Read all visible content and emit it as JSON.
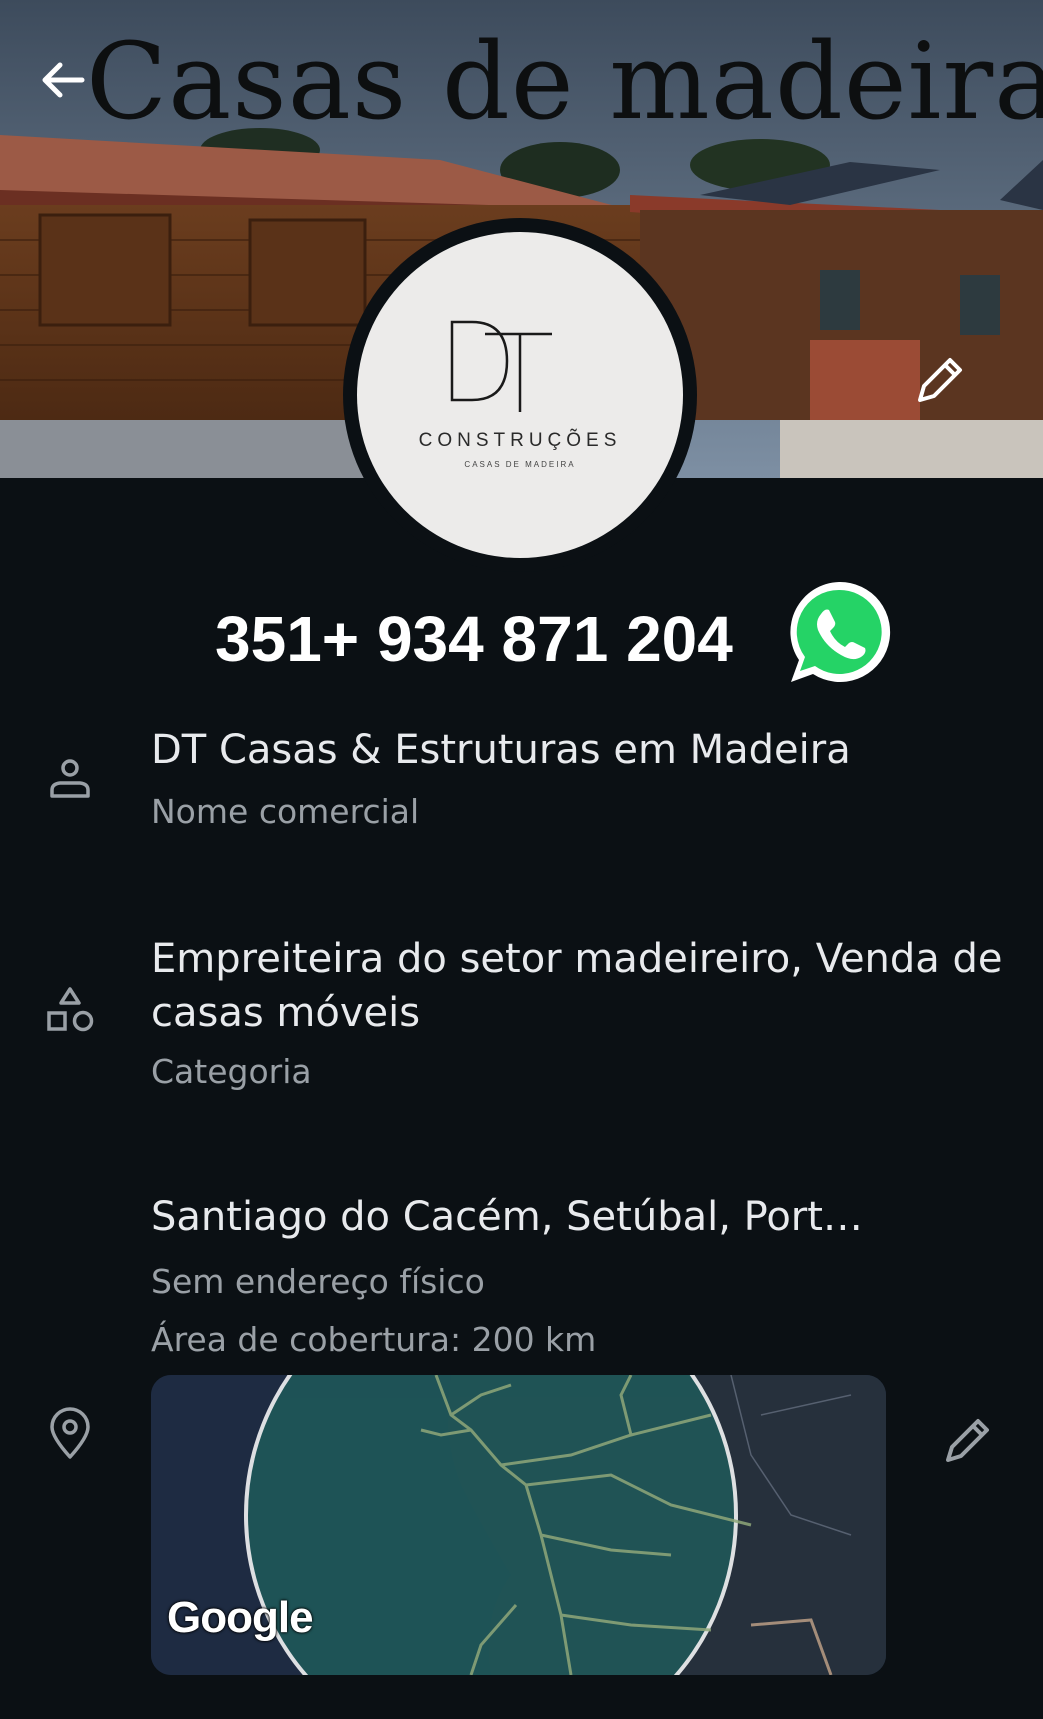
{
  "cover": {
    "title": "Casas de madeira"
  },
  "logo": {
    "monogram": "DT",
    "wordmark": "CONSTRUÇÕES",
    "tagline": "CASAS DE MADEIRA"
  },
  "contact": {
    "phone": "351+ 934 871 204",
    "phone_icon": "whatsapp-icon"
  },
  "business": {
    "name": "DT Casas & Estruturas em Madeira",
    "name_caption": "Nome comercial",
    "category_line1": "Empreiteira do setor madeireiro, Venda de",
    "category_line2": "casas móveis",
    "category_caption": "Categoria",
    "location": "Santiago do Cacém, Setúbal, Port…",
    "address_note": "Sem endereço físico",
    "coverage": "Área de cobertura: 200 km"
  },
  "map": {
    "provider": "Google"
  },
  "icons": {
    "back": "arrow-left-icon",
    "edit": "pencil-icon",
    "person": "person-icon",
    "category": "shapes-icon",
    "location": "location-pin-icon"
  },
  "colors": {
    "background": "#0b1014",
    "primary_text": "#e8eaed",
    "secondary_text": "#9aa0a6",
    "whatsapp": "#25d366",
    "map_coverage": "#1f5a5a"
  }
}
